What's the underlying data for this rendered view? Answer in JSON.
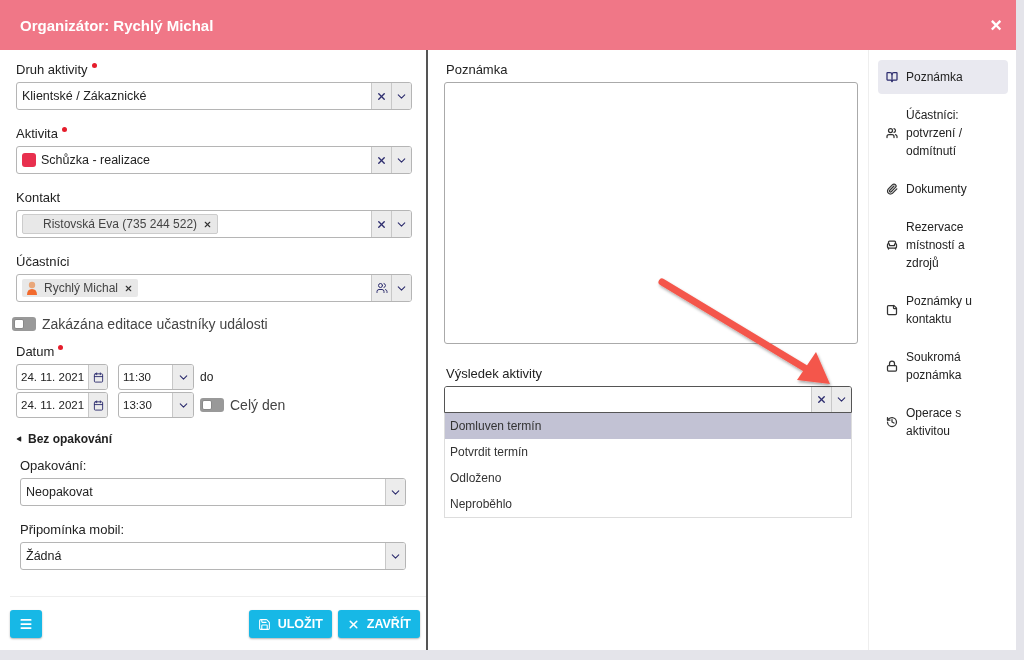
{
  "dialog": {
    "title": "Organizátor: Rychlý Michal",
    "close": "×"
  },
  "activity_type": {
    "label": "Druh aktivity",
    "required": true,
    "value": "Klientské / Zákaznické"
  },
  "activity": {
    "label": "Aktivita",
    "required": true,
    "value": "Schůzka - realizace",
    "color": "#e8304e"
  },
  "contact": {
    "label": "Kontakt",
    "tag": "Ristovská Eva (735 244 522)"
  },
  "participants": {
    "label": "Účastníci",
    "tag": "Rychlý Michal"
  },
  "edit_lock": {
    "label": "Zakázána editace učastníky události",
    "on": false
  },
  "date": {
    "label": "Datum",
    "required": true,
    "start_date": "24. 11. 2021",
    "start_time": "11:30",
    "between": "do",
    "end_date": "24. 11. 2021",
    "end_time": "13:30",
    "all_day": {
      "label": "Celý den",
      "on": false
    }
  },
  "recurrence_toggle": "Bez opakování",
  "repeat": {
    "label": "Opakování:",
    "value": "Neopakovat"
  },
  "reminder": {
    "label": "Připomínka mobil:",
    "value": "Žádná"
  },
  "buttons": {
    "save": "ULOŽIT",
    "close": "ZAVŘÍT"
  },
  "note": {
    "label": "Poznámka"
  },
  "result": {
    "label": "Výsledek aktivity",
    "options": [
      {
        "label": "Domluven termín",
        "selected": true
      },
      {
        "label": "Potvrdit termín",
        "selected": false
      },
      {
        "label": "Odloženo",
        "selected": false
      },
      {
        "label": "Neproběhlo",
        "selected": false
      }
    ]
  },
  "nav": [
    {
      "label": "Poznámka",
      "kind": "book",
      "selected": true
    },
    {
      "label": "Účastníci: potvrzení / odmítnutí",
      "kind": "users",
      "selected": false
    },
    {
      "label": "Dokumenty",
      "kind": "paperclip",
      "selected": false
    },
    {
      "label": "Rezervace místností a zdrojů",
      "kind": "chair",
      "selected": false
    },
    {
      "label": "Poznámky u kontaktu",
      "kind": "sticky",
      "selected": false
    },
    {
      "label": "Soukromá poznámka",
      "kind": "lock",
      "selected": false
    },
    {
      "label": "Operace s aktivitou",
      "kind": "history",
      "selected": false
    }
  ]
}
